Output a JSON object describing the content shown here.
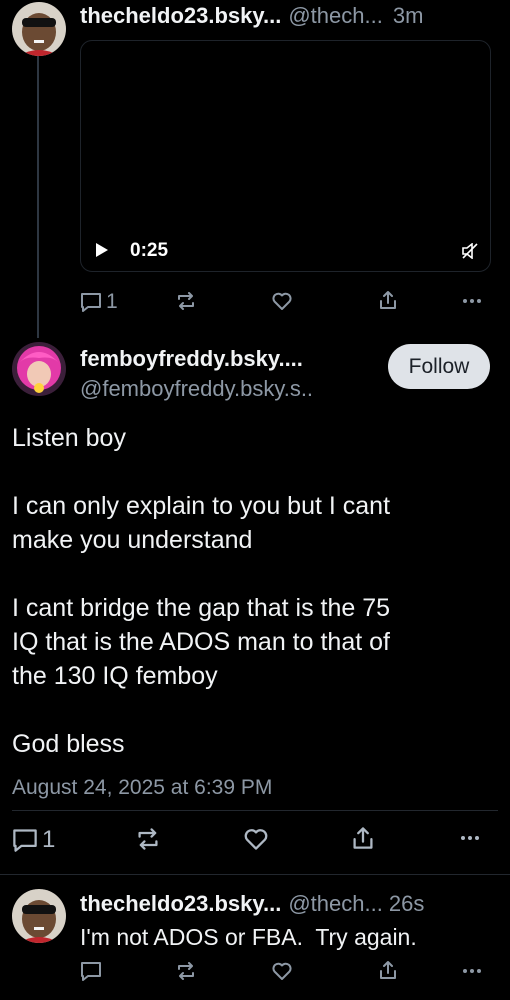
{
  "post1": {
    "display_name": "thecheldo23.bsky...",
    "handle": "@thech...",
    "time": "3m",
    "video_time": "0:25",
    "reply_count": "1"
  },
  "post2": {
    "display_name": "femboyfreddy.bsky....",
    "handle": "@femboyfreddy.bsky.s..",
    "follow_label": "Follow",
    "body": [
      "Listen boy",
      "",
      "I can only explain to you but I cant",
      "make you understand",
      "",
      "I cant bridge the gap that is the 75",
      "IQ that is the ADOS man to that of",
      "the 130 IQ femboy",
      "",
      "God bless"
    ],
    "timestamp": "August 24, 2025 at 6:39 PM",
    "reply_count": "1"
  },
  "post3": {
    "display_name": "thecheldo23.bsky...",
    "handle": "@thech...",
    "time": "26s",
    "body": "I'm not ADOS or FBA.  Try again."
  },
  "icons": {
    "reply": "reply-icon",
    "repost": "repost-icon",
    "like": "heart-icon",
    "share": "share-icon",
    "more": "more-icon",
    "play": "play-icon",
    "mute": "mute-icon"
  },
  "colors": {
    "background": "#000000",
    "text": "#f1f3f5",
    "muted": "#8d98a5",
    "follow_button_bg": "#dfe3e8",
    "thread_line": "#2e3742"
  }
}
